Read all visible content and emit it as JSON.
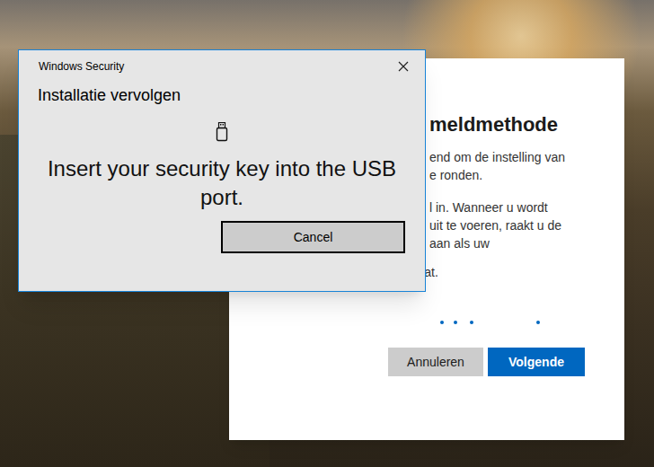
{
  "security_dialog": {
    "app_name": "Windows Security",
    "title": "Installatie vervolgen",
    "message": "Insert your security key into the USB port.",
    "button": "Cancel"
  },
  "setup_dialog": {
    "title": "meldmethode",
    "paragraph_1": [
      "end om de instelling van",
      "e ronden."
    ],
    "paragraph_2": [
      "l in. Wanneer u wordt",
      "uit te voeren, raakt u de",
      "aan als uw"
    ],
    "last_line": "beveiligingssleutel deze bevat.",
    "buttons": [
      {
        "label": "Annuleren",
        "primary": false
      },
      {
        "label": "Volgende",
        "primary": true
      }
    ]
  }
}
